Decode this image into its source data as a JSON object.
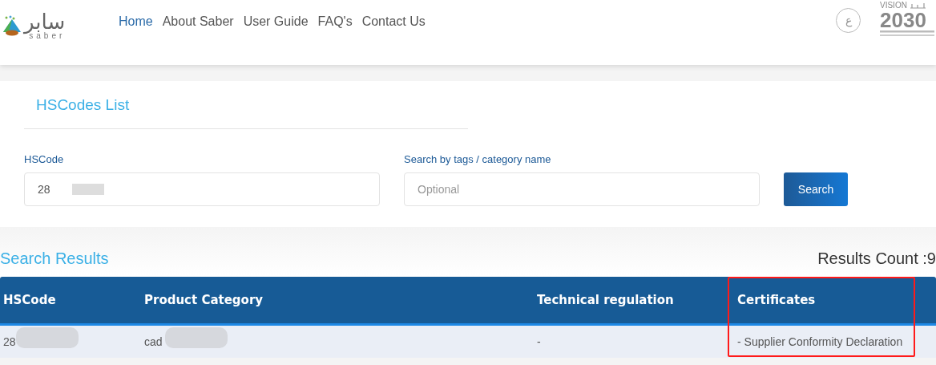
{
  "header": {
    "logo": {
      "arabic": "سابر",
      "latin": "saber"
    },
    "nav": [
      {
        "label": "Home",
        "selected": true
      },
      {
        "label": "About Saber",
        "selected": false
      },
      {
        "label": "User Guide",
        "selected": false
      },
      {
        "label": "FAQ's",
        "selected": false
      },
      {
        "label": "Contact Us",
        "selected": false
      }
    ],
    "language_button": "ع",
    "vision_logo": {
      "word": "VISION",
      "year": "2030"
    }
  },
  "panel": {
    "title": "HSCodes List",
    "fields": [
      {
        "label": "HSCode",
        "value": "28"
      },
      {
        "label": "Search by tags / category name",
        "placeholder": "Optional"
      }
    ],
    "search_button": "Search"
  },
  "results": {
    "title": "Search Results",
    "count": "Results Count :9",
    "columns": [
      {
        "label": "HSCode",
        "highlighted": false
      },
      {
        "label": "Product Category",
        "highlighted": false
      },
      {
        "label": "Technical regulation",
        "highlighted": false
      },
      {
        "label": "Certificates",
        "highlighted": true
      }
    ],
    "rows": [
      {
        "cells": [
          "28",
          "cad",
          "-",
          "- Supplier Conformity Declaration"
        ]
      }
    ]
  }
}
